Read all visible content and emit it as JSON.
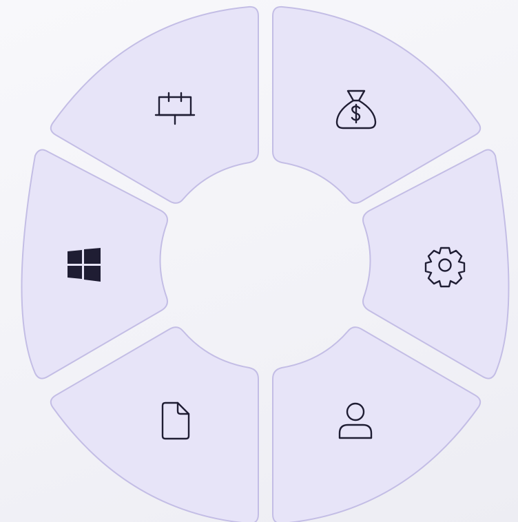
{
  "theme": {
    "segment_fill": "#e7e4f8",
    "segment_stroke": "#c3bde5",
    "icon_color": "#1f1d33",
    "background": "#f5f5f9"
  },
  "menu": {
    "segments": [
      {
        "id": "top-left",
        "icon": "presentation-board-icon"
      },
      {
        "id": "top-right",
        "icon": "money-bag-icon"
      },
      {
        "id": "right",
        "icon": "gear-icon"
      },
      {
        "id": "bottom-right",
        "icon": "user-icon"
      },
      {
        "id": "bottom-left",
        "icon": "document-icon"
      },
      {
        "id": "left",
        "icon": "windows-logo-icon"
      }
    ]
  }
}
